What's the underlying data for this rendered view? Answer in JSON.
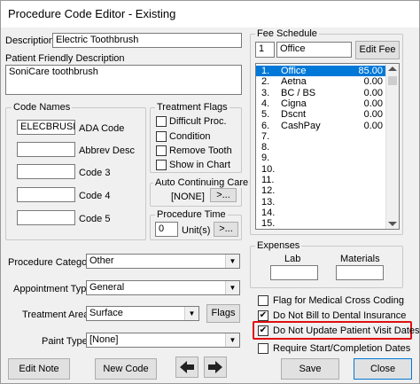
{
  "window": {
    "title": "Procedure Code Editor - Existing"
  },
  "description": {
    "label": "Description:",
    "value": "Electric Toothbrush"
  },
  "patient_desc": {
    "label": "Patient Friendly Description",
    "value": "SoniCare toothbrush"
  },
  "code_names": {
    "title": "Code Names",
    "rows": [
      {
        "value": "ELECBRUSH",
        "label": "ADA Code"
      },
      {
        "value": "",
        "label": "Abbrev Desc"
      },
      {
        "value": "",
        "label": "Code 3"
      },
      {
        "value": "",
        "label": "Code 4"
      },
      {
        "value": "",
        "label": "Code 5"
      }
    ]
  },
  "treatment_flags": {
    "title": "Treatment Flags",
    "items": [
      {
        "label": "Difficult Proc.",
        "checked": false
      },
      {
        "label": "Condition",
        "checked": false
      },
      {
        "label": "Remove Tooth",
        "checked": false
      },
      {
        "label": "Show in Chart",
        "checked": false
      }
    ]
  },
  "auto_care": {
    "title": "Auto Continuing Care",
    "value": "[NONE]",
    "button": ">..."
  },
  "proc_time": {
    "title": "Procedure Time",
    "value": "0",
    "unit_label": "Unit(s)",
    "button": ">..."
  },
  "fee_schedule": {
    "title": "Fee Schedule",
    "num": "1",
    "name": "Office",
    "edit_button": "Edit Fee",
    "rows": [
      {
        "num": "1.",
        "name": "Office",
        "fee": "85.00",
        "selected": true
      },
      {
        "num": "2.",
        "name": "Aetna",
        "fee": "0.00",
        "selected": false
      },
      {
        "num": "3.",
        "name": "BC / BS",
        "fee": "0.00",
        "selected": false
      },
      {
        "num": "4.",
        "name": "Cigna",
        "fee": "0.00",
        "selected": false
      },
      {
        "num": "5.",
        "name": "Dscnt",
        "fee": "0.00",
        "selected": false
      },
      {
        "num": "6.",
        "name": "CashPay",
        "fee": "0.00",
        "selected": false
      },
      {
        "num": "7.",
        "name": "",
        "fee": "",
        "selected": false
      },
      {
        "num": "8.",
        "name": "",
        "fee": "",
        "selected": false
      },
      {
        "num": "9.",
        "name": "",
        "fee": "",
        "selected": false
      },
      {
        "num": "10.",
        "name": "",
        "fee": "",
        "selected": false
      },
      {
        "num": "11.",
        "name": "",
        "fee": "",
        "selected": false
      },
      {
        "num": "12.",
        "name": "",
        "fee": "",
        "selected": false
      },
      {
        "num": "13.",
        "name": "",
        "fee": "",
        "selected": false
      },
      {
        "num": "14.",
        "name": "",
        "fee": "",
        "selected": false
      },
      {
        "num": "15.",
        "name": "",
        "fee": "",
        "selected": false
      }
    ]
  },
  "expenses": {
    "title": "Expenses",
    "lab_label": "Lab",
    "materials_label": "Materials",
    "lab_value": "",
    "materials_value": ""
  },
  "procedure_category": {
    "label": "Procedure Category:",
    "value": "Other"
  },
  "appointment_type": {
    "label": "Appointment Type:",
    "value": "General"
  },
  "treatment_area": {
    "label": "Treatment Area:",
    "value": "Surface",
    "flags_button": "Flags"
  },
  "paint_type": {
    "label": "Paint Type:",
    "value": "[None]"
  },
  "options": [
    {
      "label": "Flag for Medical Cross Coding",
      "checked": false
    },
    {
      "label": "Do Not Bill to Dental Insurance",
      "checked": true
    },
    {
      "label": "Do Not Update Patient Visit Dates",
      "checked": true
    },
    {
      "label": "Require Start/Completion Dates",
      "checked": false
    }
  ],
  "buttons": {
    "edit_note": "Edit Note",
    "new_code": "New Code",
    "save": "Save",
    "close": "Close"
  },
  "icons": {
    "arrow_left": "arrow-left-icon",
    "arrow_right": "arrow-right-icon",
    "dropdown": "chevron-down-icon"
  },
  "colors": {
    "selection": "#0078d7",
    "highlight": "#e01010"
  }
}
